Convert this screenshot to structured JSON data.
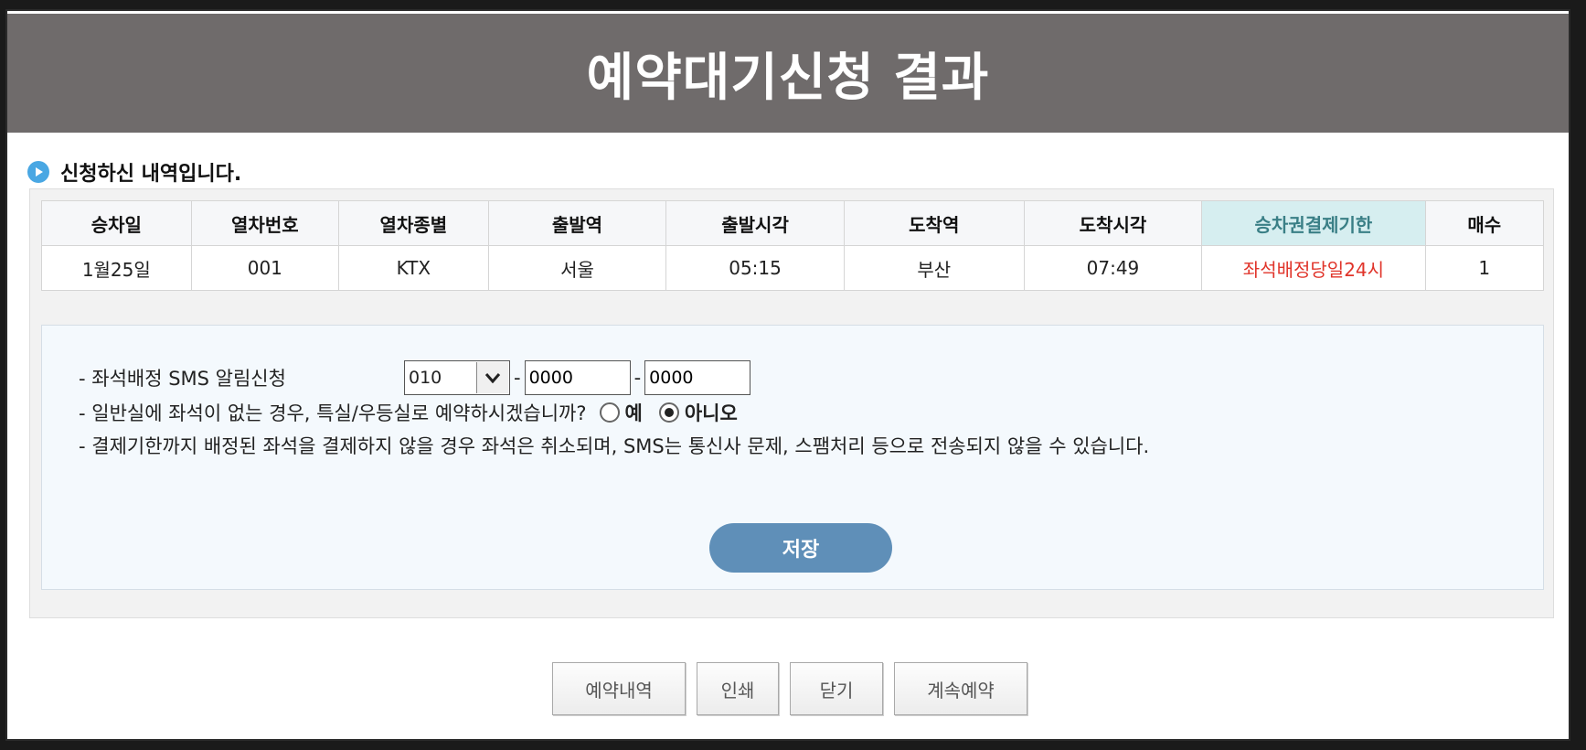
{
  "header": {
    "title": "예약대기신청 결과"
  },
  "section": {
    "title": "신청하신 내역입니다."
  },
  "table": {
    "headers": [
      "승차일",
      "열차번호",
      "열차종별",
      "출발역",
      "출발시각",
      "도착역",
      "도착시각",
      "승차권결제기한",
      "매수"
    ],
    "row": [
      "1월25일",
      "001",
      "KTX",
      "서울",
      "05:15",
      "부산",
      "07:49",
      "좌석배정당일24시",
      "1"
    ]
  },
  "form": {
    "sms_label": "- 좌석배정 SMS 알림신청",
    "phone_prefix": "010",
    "phone_mid": "0000",
    "phone_last": "0000",
    "dash": "-",
    "question": "- 일반실에 좌석이 없는 경우, 특실/우등실로 예약하시겠습니까?",
    "option_yes": "예",
    "option_no": "아니오",
    "notice": "- 결제기한까지 배정된 좌석을 결제하지 않을 경우 좌석은 취소되며, SMS는 통신사 문제, 스팸처리 등으로 전송되지 않을 수 있습니다.",
    "save_label": "저장"
  },
  "buttons": {
    "history": "예약내역",
    "print": "인쇄",
    "close": "닫기",
    "continue": "계속예약"
  },
  "colors": {
    "header_bg": "#6f6b6b",
    "accent_blue": "#5f8fb8",
    "deadline_red": "#e0342a"
  }
}
